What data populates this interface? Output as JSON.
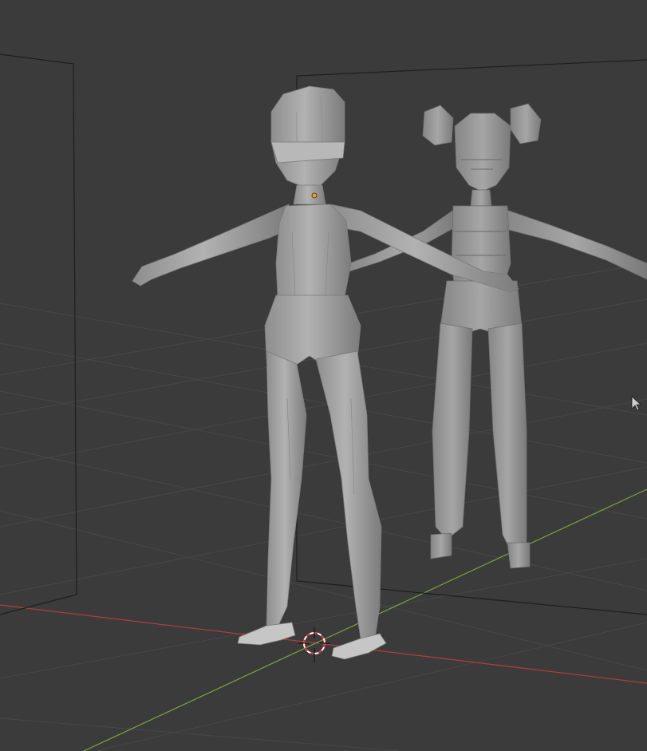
{
  "viewport": {
    "background_color": "#3b3b3b",
    "grid_color": "#4a4a4a",
    "x_axis_color": "#b43c3c",
    "y_axis_color": "#7aa33a",
    "reference_frame_color": "#1e1e1e",
    "selected_origin_color": "#f0a020",
    "cursor_color": "#cfcfcf"
  },
  "scene": {
    "objects": [
      {
        "name": "low-poly-body-mesh",
        "color": "#a4a4a4"
      },
      {
        "name": "reference-character-mesh",
        "color": "#9a9a9a"
      }
    ],
    "icons": [
      "3d-cursor-icon",
      "mouse-pointer-icon",
      "origin-point-icon"
    ]
  }
}
